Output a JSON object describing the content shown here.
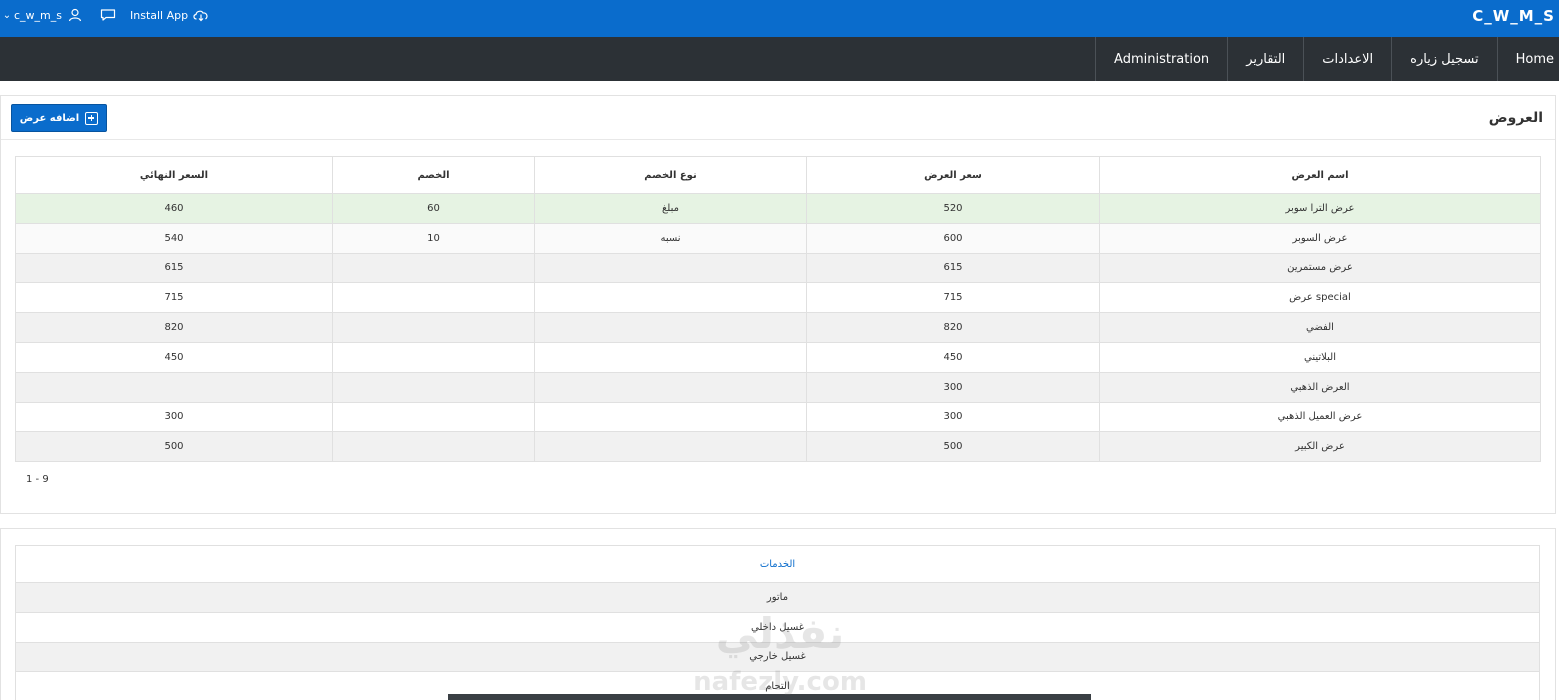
{
  "header": {
    "username": "c_w_m_s",
    "install_label": "Install App",
    "brand": "C_W_M_S",
    "bg_color": "#0a6ccc"
  },
  "nav": {
    "items": [
      "Home",
      "تسجيل زياره",
      "الاعدادات",
      "التقارير",
      "Administration"
    ]
  },
  "offers": {
    "title": "العروض",
    "add_button_label": "اضافه عرض",
    "columns": [
      "اسم العرض",
      "سعر العرض",
      "نوع الخصم",
      "الخصم",
      "السعر النهائي"
    ],
    "rows": [
      [
        "عرض الترا سوبر",
        "520",
        "مبلغ",
        "60",
        "460"
      ],
      [
        "عرض السوبر",
        "600",
        "نسبه",
        "10",
        "540"
      ],
      [
        "عرض مستمرين",
        "615",
        "",
        "",
        "615"
      ],
      [
        "عرض special",
        "715",
        "",
        "",
        "715"
      ],
      [
        "الفضي",
        "820",
        "",
        "",
        "820"
      ],
      [
        "البلاتيني",
        "450",
        "",
        "",
        "450"
      ],
      [
        "العرض الذهبي",
        "300",
        "",
        "",
        ""
      ],
      [
        "عرض العميل الذهبي",
        "300",
        "",
        "",
        "300"
      ],
      [
        "عرض الكبير",
        "500",
        "",
        "",
        "500"
      ]
    ],
    "pagination": "1 - 9"
  },
  "services": {
    "column": "الخدمات",
    "rows": [
      "ماتور",
      "غسيل داخلي",
      "غسيل خارجي",
      "التحام"
    ]
  },
  "watermark": {
    "arabic": "نفذلي",
    "latin": "nafezly.com"
  }
}
